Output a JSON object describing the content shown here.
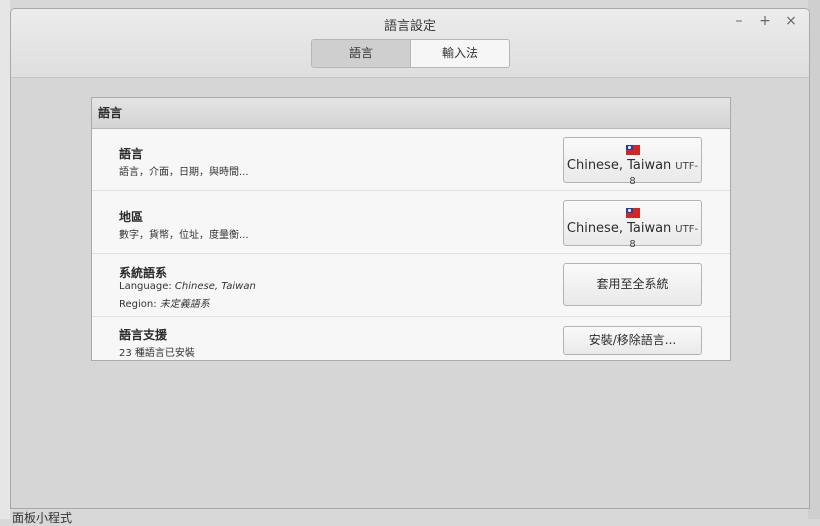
{
  "window": {
    "title": "語言設定"
  },
  "wm": {
    "minimize": "–",
    "maximize": "+",
    "close": "×"
  },
  "tabs": [
    {
      "label": "語言"
    },
    {
      "label": "輸入法"
    }
  ],
  "panel": {
    "header": "語言",
    "rows": [
      {
        "title": "語言",
        "subtitle": "語言，介面，日期，與時間...",
        "button_locale": "Chinese, Taiwan",
        "button_encoding": "UTF-8"
      },
      {
        "title": "地區",
        "subtitle": "數字，貨幣，位址，度量衡...",
        "button_locale": "Chinese, Taiwan",
        "button_encoding": "UTF-8"
      },
      {
        "title": "系統語系",
        "language_label": "Language: ",
        "language_value": "Chinese, Taiwan",
        "region_label": "Region: ",
        "region_value": "未定義語系",
        "button": "套用至全系統"
      },
      {
        "title": "語言支援",
        "subtitle": "23 種語言已安裝",
        "button": "安裝/移除語言..."
      }
    ]
  },
  "background": {
    "partial_text": "面板小程式"
  }
}
